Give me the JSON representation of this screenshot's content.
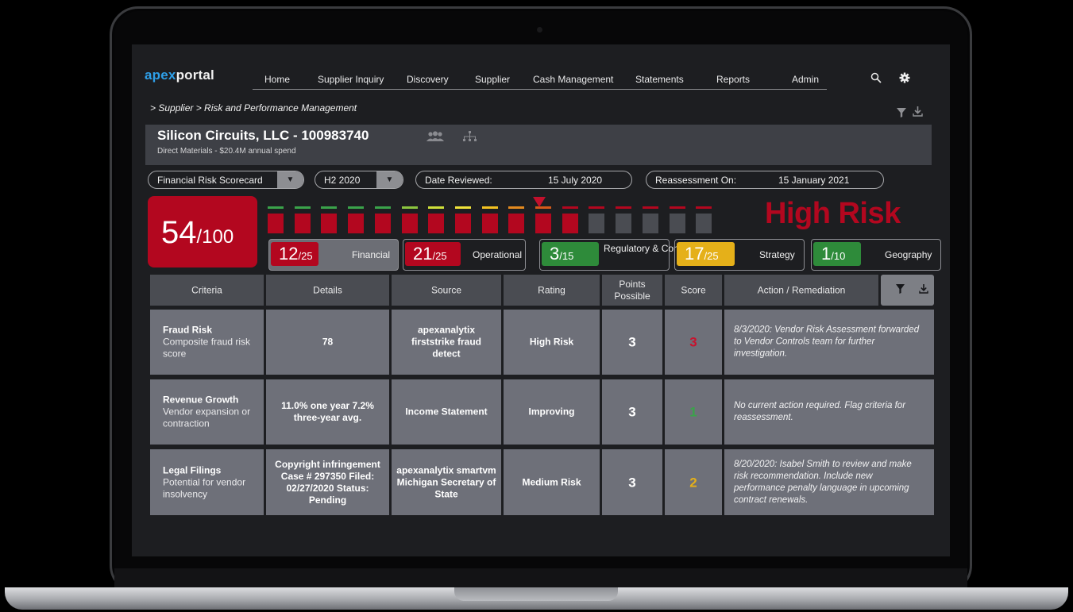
{
  "header": {
    "logo_apex": "apex",
    "logo_portal": "portal",
    "nav": [
      "Home",
      "Supplier Inquiry",
      "Discovery",
      "Supplier",
      "Cash Management",
      "Statements",
      "Reports",
      "Admin"
    ],
    "search_icon": "search-icon",
    "settings_icon": "gear-icon"
  },
  "breadcrumb": "> Supplier > Risk and Performance Management",
  "supplier": {
    "name": "Silicon Circuits, LLC - 100983740",
    "subtitle": "Direct Materials - $20.4M annual spend"
  },
  "filters": {
    "scorecard": "Financial Risk Scorecard",
    "period": "H2 2020",
    "date_reviewed_label": "Date Reviewed:",
    "date_reviewed": "15 July 2020",
    "reassessment_label": "Reassessment On:",
    "reassessment": "15 January 2021"
  },
  "score": {
    "value": "54",
    "max": "/100",
    "risk_label": "High Risk",
    "gauge_position": 0.54
  },
  "categories": [
    {
      "score": "12",
      "max": "/25",
      "name": "Financial"
    },
    {
      "score": "21",
      "max": "/25",
      "name": "Operational"
    },
    {
      "score": "3",
      "max": "/15",
      "name": "Regulatory & Compliance"
    },
    {
      "score": "17",
      "max": "/25",
      "name": "Strategy"
    },
    {
      "score": "1",
      "max": "/10",
      "name": "Geography"
    }
  ],
  "colors": {
    "high": "#b3071f",
    "green": "#2e8b3a",
    "yellow": "#e5b019",
    "accent": "#2e9fe8"
  },
  "table": {
    "headers": [
      "Criteria",
      "Details",
      "Source",
      "Rating",
      "Points Possible",
      "Score",
      "Action / Remediation"
    ],
    "rows": [
      {
        "title": "Fraud Risk",
        "subtitle": "Composite fraud risk score",
        "details": "78",
        "source": "apexanalytix firststrike fraud detect",
        "rating": "High Risk",
        "points": "3",
        "score": "3",
        "action": "8/3/2020: Vendor Risk Assessment forwarded to Vendor Controls team for further investigation."
      },
      {
        "title": "Revenue Growth",
        "subtitle": "Vendor expansion or contraction",
        "details": "11.0% one year 7.2% three-year avg.",
        "source": "Income Statement",
        "rating": "Improving",
        "points": "3",
        "score": "1",
        "action": "No current action required. Flag criteria for reassessment."
      },
      {
        "title": "Legal Filings",
        "subtitle": "Potential for vendor insolvency",
        "details": "Copyright infringement Case # 297350 Filed: 02/27/2020 Status: Pending",
        "source": "apexanalytix smartvm Michigan Secretary of State",
        "rating": "Medium Risk",
        "points": "3",
        "score": "2",
        "action": "8/20/2020: Isabel Smith to review and make risk recommendation.  Include new performance penalty language in upcoming contract renewals."
      }
    ]
  }
}
